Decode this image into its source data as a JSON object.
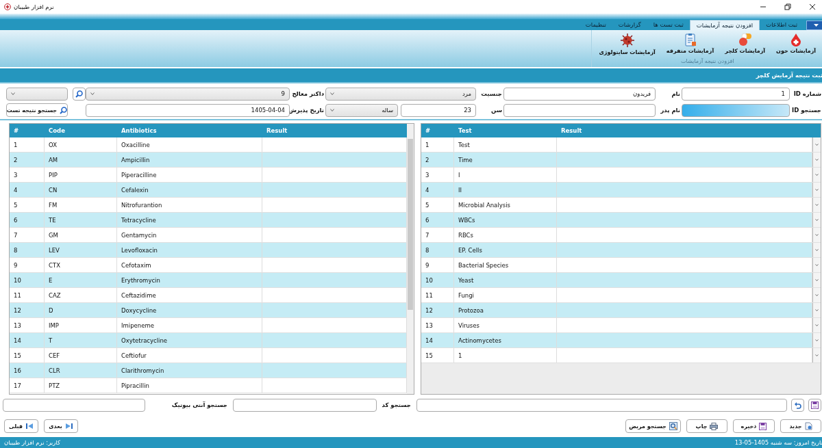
{
  "window": {
    "title": "نرم افزار طبیبان"
  },
  "ribbon": {
    "tabs": [
      {
        "label": "ثبت اطلاعات",
        "selected": false
      },
      {
        "label": "افزودن نتیجه آزمایشات",
        "selected": true
      },
      {
        "label": "ثبت تست ها",
        "selected": false
      },
      {
        "label": "گزارشات",
        "selected": false
      },
      {
        "label": "تنظیمات",
        "selected": false
      }
    ],
    "group": {
      "label": "افزودن نتیجه آزمایشات",
      "buttons": [
        {
          "label": "آزمایشات خون"
        },
        {
          "label": "آزمایشات کلچر"
        },
        {
          "label": "آزمایشات متفرقه"
        },
        {
          "label": "آزمایشات سایتولوژی"
        }
      ]
    }
  },
  "section_title": "ثبت نتیجه آزمایش کلچر",
  "form": {
    "rows": [
      [
        {
          "kind": "label",
          "text": "شماره ID"
        },
        {
          "kind": "input",
          "value": "1"
        },
        {
          "kind": "label",
          "text": "نام"
        },
        {
          "kind": "input",
          "value": "فریدون"
        },
        {
          "kind": "label",
          "text": "جنسیت"
        },
        {
          "kind": "combo",
          "value": "مرد"
        },
        {
          "kind": "label",
          "text": "داکتر معالج"
        },
        {
          "kind": "combo",
          "value": "9"
        },
        {
          "kind": "icon_button"
        },
        {
          "kind": "combo"
        }
      ],
      [
        {
          "kind": "label",
          "text": "جستجو ID"
        },
        {
          "kind": "id_search"
        },
        {
          "kind": "label",
          "text": "نام پدر"
        },
        {
          "kind": "input"
        },
        {
          "kind": "label",
          "text": "سن"
        },
        {
          "kind": "age",
          "value": "23",
          "unit": "ساله"
        },
        {
          "kind": "label",
          "text": "تاریخ پذیرش"
        },
        {
          "kind": "input",
          "value": "1405-04-04"
        },
        {
          "kind": "spacer"
        },
        {
          "kind": "button",
          "label": "جستجو نتیجه تست"
        }
      ]
    ]
  },
  "tests_table": {
    "columns": [
      "Result",
      "Test",
      "#"
    ],
    "rows": [
      {
        "num": "1",
        "test": "Test"
      },
      {
        "num": "2",
        "test": "Time"
      },
      {
        "num": "3",
        "test": "I"
      },
      {
        "num": "4",
        "test": "II"
      },
      {
        "num": "5",
        "test": "Microbial Analysis"
      },
      {
        "num": "6",
        "test": "WBCs"
      },
      {
        "num": "7",
        "test": "RBCs"
      },
      {
        "num": "8",
        "test": "EP. Cells"
      },
      {
        "num": "9",
        "test": "Bacterial Species"
      },
      {
        "num": "10",
        "test": "Yeast"
      },
      {
        "num": "11",
        "test": "Fungi"
      },
      {
        "num": "12",
        "test": "Protozoa"
      },
      {
        "num": "13",
        "test": "Viruses"
      },
      {
        "num": "14",
        "test": "Actinomycetes"
      },
      {
        "num": "15",
        "test": "1"
      }
    ]
  },
  "antibiotics_table": {
    "columns": [
      "Result",
      "Antibiotics",
      "Code",
      "#"
    ],
    "rows": [
      {
        "num": "1",
        "code": "OX",
        "name": "Oxacilline"
      },
      {
        "num": "2",
        "code": "AM",
        "name": "Ampicillin"
      },
      {
        "num": "3",
        "code": "PIP",
        "name": "Piperacilline"
      },
      {
        "num": "4",
        "code": "CN",
        "name": "Cefalexin"
      },
      {
        "num": "5",
        "code": "FM",
        "name": "Nitrofurantion"
      },
      {
        "num": "6",
        "code": "TE",
        "name": "Tetracycline"
      },
      {
        "num": "7",
        "code": "GM",
        "name": "Gentamycin"
      },
      {
        "num": "8",
        "code": "LEV",
        "name": "Levofloxacin"
      },
      {
        "num": "9",
        "code": "CTX",
        "name": "Cefotaxim"
      },
      {
        "num": "10",
        "code": "E",
        "name": "Erythromycin"
      },
      {
        "num": "11",
        "code": "CAZ",
        "name": "Ceftazidime"
      },
      {
        "num": "12",
        "code": "D",
        "name": "Doxycycline"
      },
      {
        "num": "13",
        "code": "IMP",
        "name": "Imipeneme"
      },
      {
        "num": "14",
        "code": "T",
        "name": "Oxytetracycline"
      },
      {
        "num": "15",
        "code": "CEF",
        "name": "Ceftiofur"
      },
      {
        "num": "16",
        "code": "CLR",
        "name": "Clarithromycin"
      },
      {
        "num": "17",
        "code": "PTZ",
        "name": "Pipracillin"
      }
    ]
  },
  "search_bar": {
    "code_label": "جستجو کد",
    "antibiotic_label": "جستجو آنتی بیوتیک"
  },
  "actions": [
    {
      "label": "جدید"
    },
    {
      "label": "ذخیره"
    },
    {
      "label": "چاپ"
    },
    {
      "label": "جستجو مریض"
    }
  ],
  "navigation": [
    {
      "label": "بعدی"
    },
    {
      "label": "قبلی"
    }
  ],
  "status_bar": {
    "date": "تاریخ امروز: سه شنبه  1405-05-13",
    "user": "کاربر: نرم افزار طبیبان"
  }
}
